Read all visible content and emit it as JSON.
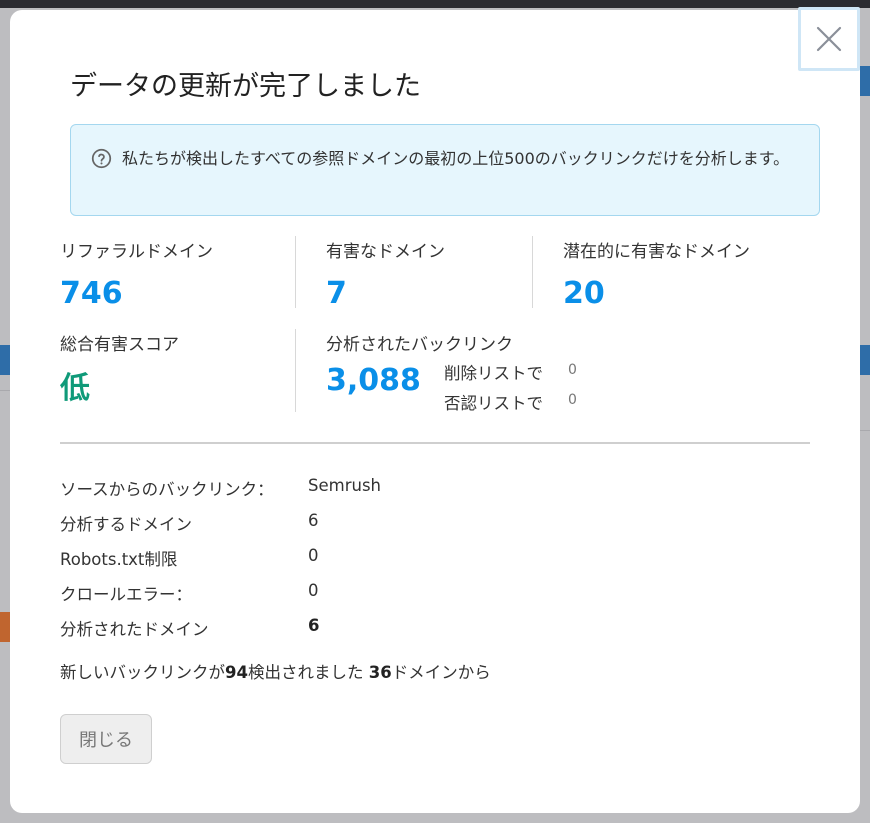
{
  "dialog": {
    "title": "データの更新が完了しました",
    "info": "私たちが検出したすべての参照ドメインの最初の上位500のバックリンクだけを分析します。",
    "stats": {
      "referral_domains": {
        "label": "リファラルドメイン",
        "value": "746"
      },
      "toxic_domains": {
        "label": "有害なドメイン",
        "value": "7"
      },
      "potentially_toxic": {
        "label": "潜在的に有害なドメイン",
        "value": "20"
      },
      "overall_toxic_score": {
        "label": "総合有害スコア",
        "value": "低"
      },
      "analyzed_backlinks": {
        "label": "分析されたバックリンク",
        "value": "3,088",
        "remove_label": "削除リストで",
        "remove_count": "0",
        "disavow_label": "否認リストで",
        "disavow_count": "0"
      }
    },
    "details": [
      {
        "label": "ソースからのバックリンク：",
        "value": "Semrush"
      },
      {
        "label": "分析するドメイン",
        "value": "6"
      },
      {
        "label": "Robots.txt制限",
        "value": "0"
      },
      {
        "label": "クロールエラー：",
        "value": "0"
      },
      {
        "label": "分析されたドメイン",
        "value": "6"
      }
    ],
    "summary": {
      "prefix": "新しいバックリンクが",
      "new_backlinks": "94",
      "middle": "検出されました ",
      "domains": "36",
      "suffix": "ドメインから"
    },
    "close_button": "閉じる"
  },
  "colors": {
    "accent_blue": "#0a8fe8",
    "score_green": "#0f9a79",
    "info_bg": "#e6f6fd"
  }
}
